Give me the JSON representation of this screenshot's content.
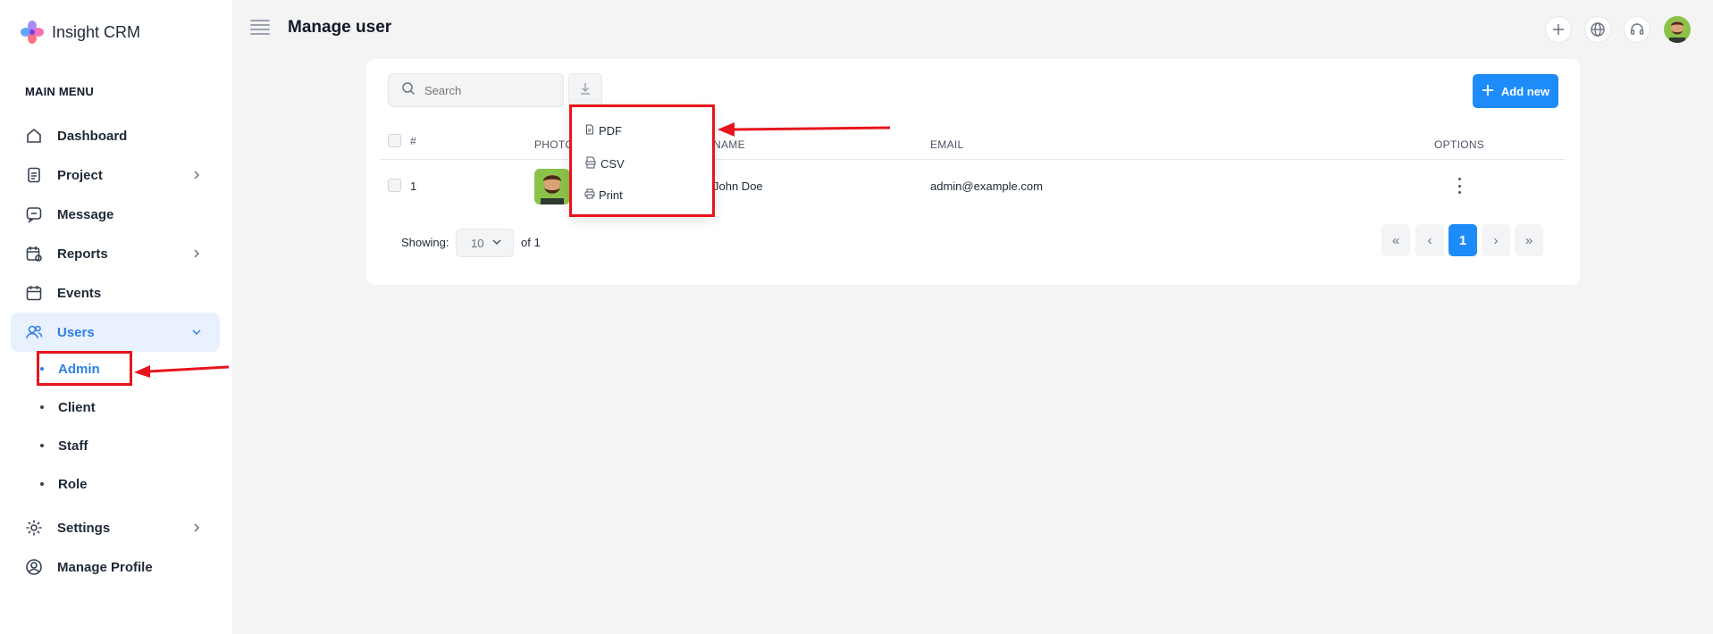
{
  "app": {
    "name": "Insight CRM"
  },
  "sidebar": {
    "heading": "MAIN MENU",
    "items": [
      {
        "label": "Dashboard",
        "icon": "home-icon",
        "has_chevron": false
      },
      {
        "label": "Project",
        "icon": "document-icon",
        "has_chevron": true
      },
      {
        "label": "Message",
        "icon": "chat-icon",
        "has_chevron": false
      },
      {
        "label": "Reports",
        "icon": "calendar-report-icon",
        "has_chevron": true
      },
      {
        "label": "Events",
        "icon": "calendar-icon",
        "has_chevron": false
      },
      {
        "label": "Users",
        "icon": "users-icon",
        "has_chevron": true,
        "expanded": true,
        "active": true
      },
      {
        "label": "Settings",
        "icon": "gear-icon",
        "has_chevron": true
      },
      {
        "label": "Manage Profile",
        "icon": "profile-icon",
        "has_chevron": false
      }
    ],
    "users_submenu": [
      {
        "label": "Admin",
        "active": true
      },
      {
        "label": "Client"
      },
      {
        "label": "Staff"
      },
      {
        "label": "Role"
      }
    ]
  },
  "header": {
    "title": "Manage user",
    "actions": [
      "plus-icon",
      "globe-icon",
      "headset-icon",
      "avatar"
    ]
  },
  "toolbar": {
    "search_placeholder": "Search",
    "add_label": "Add new"
  },
  "export_menu": {
    "items": [
      {
        "label": "PDF",
        "icon": "pdf-file-icon"
      },
      {
        "label": "CSV",
        "icon": "csv-file-icon"
      },
      {
        "label": "Print",
        "icon": "printer-icon"
      }
    ]
  },
  "table": {
    "columns": [
      "#",
      "PHOTO",
      "NAME",
      "EMAIL",
      "OPTIONS"
    ],
    "rows": [
      {
        "id": "1",
        "name": "John Doe",
        "email": "admin@example.com"
      }
    ]
  },
  "pagination": {
    "showing_label": "Showing:",
    "per_page": "10",
    "of_total": "of 1",
    "first": "«",
    "prev": "‹",
    "current": "1",
    "next": "›",
    "last": "»"
  },
  "colors": {
    "accent": "#1d8cf8",
    "active_text": "#2f7fe6",
    "active_bg": "#e8f1fd",
    "annotation": "#e8141c"
  }
}
